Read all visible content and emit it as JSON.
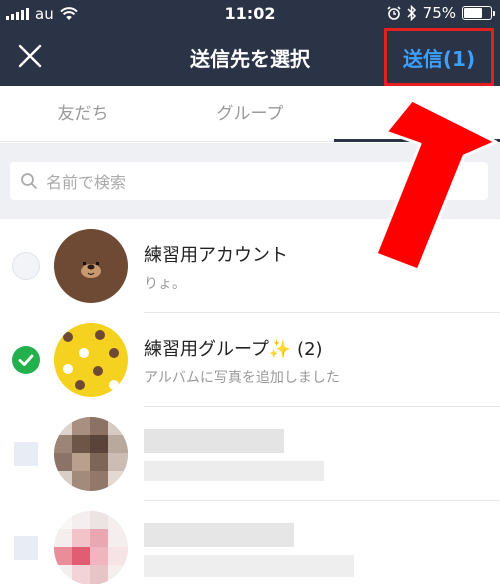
{
  "status_bar": {
    "carrier": "au",
    "time": "11:02",
    "battery_percent": "75%",
    "battery_level": 0.75
  },
  "nav": {
    "title": "送信先を選択",
    "send_label": "送信(1)",
    "close_icon": "close-icon"
  },
  "tabs": [
    {
      "label": "友だち",
      "active": false
    },
    {
      "label": "グループ",
      "active": false
    },
    {
      "label": "ク",
      "active": true
    }
  ],
  "search": {
    "placeholder": "名前で検索"
  },
  "list": [
    {
      "name": "練習用アカウント",
      "sub": "りょ。",
      "checked": false
    },
    {
      "name": "練習用グループ✨ (2)",
      "sub": "アルバムに写真を追加しました",
      "checked": true
    },
    {
      "name": "",
      "sub": "",
      "checked": false
    },
    {
      "name": "",
      "sub": "",
      "checked": false
    }
  ],
  "colors": {
    "header_bg": "#2b3446",
    "send_text": "#3da0ff",
    "highlight_border": "#e51f1f",
    "check_on": "#22b14c"
  }
}
